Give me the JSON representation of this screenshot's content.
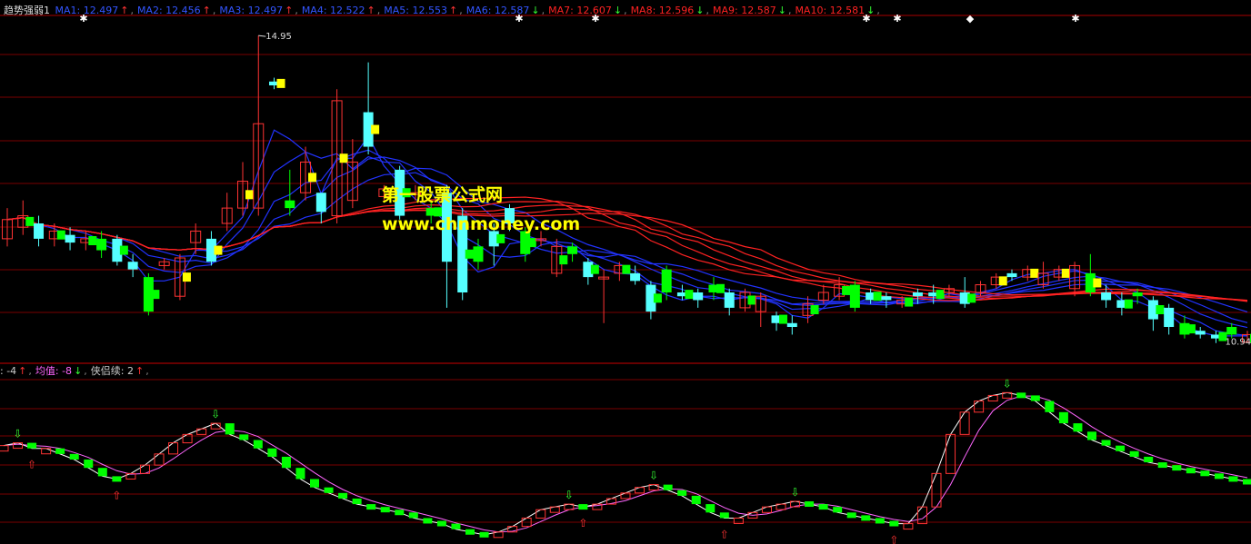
{
  "header": {
    "title": "趋势强弱1",
    "ma_items": [
      {
        "label": "MA1: 12.497",
        "arrow": "↑",
        "color": "#3355ff",
        "arrow_color": "#ff3333"
      },
      {
        "label": "MA2: 12.456",
        "arrow": "↑",
        "color": "#3355ff",
        "arrow_color": "#ff3333"
      },
      {
        "label": "MA3: 12.497",
        "arrow": "↑",
        "color": "#3355ff",
        "arrow_color": "#ff3333"
      },
      {
        "label": "MA4: 12.522",
        "arrow": "↑",
        "color": "#3355ff",
        "arrow_color": "#ff3333"
      },
      {
        "label": "MA5: 12.553",
        "arrow": "↑",
        "color": "#3355ff",
        "arrow_color": "#ff3333"
      },
      {
        "label": "MA6: 12.587",
        "arrow": "↓",
        "color": "#3355ff",
        "arrow_color": "#33ff33"
      },
      {
        "label": "MA7: 12.607",
        "arrow": "↓",
        "color": "#ff2222",
        "arrow_color": "#33ff33"
      },
      {
        "label": "MA8: 12.596",
        "arrow": "↓",
        "color": "#ff2222",
        "arrow_color": "#33ff33"
      },
      {
        "label": "MA9: 12.587",
        "arrow": "↓",
        "color": "#ff2222",
        "arrow_color": "#33ff33"
      },
      {
        "label": "MA10: 12.581",
        "arrow": "↓",
        "color": "#ff2222",
        "arrow_color": "#33ff33"
      }
    ]
  },
  "subheader": {
    "items": [
      {
        "label": ": -4",
        "arrow": "↑",
        "color": "#cccccc",
        "arrow_color": "#ff3333"
      },
      {
        "label": "均值: -8",
        "arrow": "↓",
        "color": "#ff66ff",
        "arrow_color": "#33ff33"
      },
      {
        "label": "侠侣续: 2",
        "arrow": "↑",
        "color": "#cccccc",
        "arrow_color": "#ff3333"
      }
    ]
  },
  "watermark": {
    "line1": "第一股票公式网",
    "line2": "www.chnmoney.com"
  },
  "annotations": {
    "high": "14.95",
    "low": "10.94"
  },
  "colors": {
    "up_hollow": "#ff3333",
    "down_cyan": "#55ffff",
    "down_green": "#00ff00",
    "yellow": "#ffff00",
    "ma_blue": "#2233ff",
    "ma_red": "#ff2222",
    "avg_line": "#ff66ff",
    "grid": "#7a0000"
  },
  "chart_data": [
    {
      "type": "candlestick",
      "title": "趋势强弱1",
      "n": 80,
      "ohlc": [
        [
          12.3,
          12.55,
          12.7,
          12.2
        ],
        [
          12.45,
          12.6,
          12.8,
          12.35
        ],
        [
          12.5,
          12.3,
          12.6,
          12.2
        ],
        [
          12.3,
          12.4,
          12.5,
          12.2
        ],
        [
          12.35,
          12.25,
          12.45,
          12.15
        ],
        [
          12.25,
          12.3,
          12.4,
          12.15
        ],
        [
          12.3,
          12.15,
          12.4,
          12.05
        ],
        [
          12.3,
          12.0,
          12.35,
          11.95
        ],
        [
          12.0,
          11.9,
          12.1,
          11.8
        ],
        [
          11.8,
          11.35,
          11.85,
          11.3
        ],
        [
          11.95,
          12.0,
          12.05,
          11.9
        ],
        [
          11.55,
          12.05,
          12.1,
          11.5
        ],
        [
          12.25,
          12.4,
          12.5,
          12.1
        ],
        [
          12.3,
          12.0,
          12.4,
          11.95
        ],
        [
          12.5,
          12.7,
          12.9,
          12.4
        ],
        [
          12.7,
          13.05,
          13.3,
          12.6
        ],
        [
          12.7,
          13.8,
          14.95,
          12.6
        ],
        [
          14.35,
          14.3,
          14.4,
          14.25
        ],
        [
          12.8,
          12.7,
          13.2,
          12.6
        ],
        [
          12.9,
          13.3,
          13.5,
          12.8
        ],
        [
          12.9,
          12.65,
          12.7,
          12.5
        ],
        [
          12.6,
          14.1,
          14.25,
          12.5
        ],
        [
          12.8,
          13.3,
          13.6,
          12.7
        ],
        [
          13.95,
          13.5,
          14.6,
          13.4
        ],
        [
          12.85,
          12.95,
          13.0,
          12.8
        ],
        [
          13.2,
          12.6,
          13.25,
          12.55
        ],
        [
          12.9,
          12.9,
          13.0,
          12.8
        ],
        [
          12.7,
          12.6,
          12.8,
          12.5
        ],
        [
          12.9,
          12.0,
          13.0,
          11.4
        ],
        [
          12.6,
          11.6,
          12.7,
          11.5
        ],
        [
          12.2,
          12.0,
          12.3,
          11.9
        ],
        [
          12.4,
          12.2,
          12.5,
          11.95
        ],
        [
          12.7,
          12.5,
          12.75,
          12.4
        ],
        [
          12.4,
          12.1,
          12.45,
          12.0
        ],
        [
          12.3,
          12.3,
          12.4,
          12.2
        ],
        [
          11.85,
          12.2,
          12.3,
          11.8
        ],
        [
          12.2,
          12.1,
          12.25,
          12.0
        ],
        [
          12.0,
          11.8,
          12.05,
          11.7
        ],
        [
          11.8,
          11.8,
          11.9,
          11.2
        ],
        [
          11.85,
          11.95,
          12.0,
          11.75
        ],
        [
          11.85,
          11.75,
          11.95,
          11.7
        ],
        [
          11.7,
          11.35,
          11.75,
          11.25
        ],
        [
          11.9,
          11.6,
          11.95,
          11.5
        ],
        [
          11.6,
          11.55,
          11.7,
          11.5
        ],
        [
          11.6,
          11.5,
          11.65,
          11.4
        ],
        [
          11.7,
          11.6,
          11.8,
          11.5
        ],
        [
          11.6,
          11.4,
          11.65,
          11.3
        ],
        [
          11.4,
          11.6,
          11.65,
          11.35
        ],
        [
          11.35,
          11.55,
          11.6,
          11.15
        ],
        [
          11.3,
          11.2,
          11.35,
          11.1
        ],
        [
          11.2,
          11.15,
          11.3,
          11.05
        ],
        [
          11.3,
          11.45,
          11.55,
          11.2
        ],
        [
          11.5,
          11.6,
          11.7,
          11.45
        ],
        [
          11.55,
          11.7,
          11.8,
          11.5
        ],
        [
          11.7,
          11.4,
          11.75,
          11.35
        ],
        [
          11.6,
          11.5,
          11.65,
          11.45
        ],
        [
          11.55,
          11.5,
          11.6,
          11.4
        ],
        [
          11.45,
          11.5,
          11.55,
          11.4
        ],
        [
          11.6,
          11.55,
          11.65,
          11.45
        ],
        [
          11.6,
          11.55,
          11.7,
          11.45
        ],
        [
          11.6,
          11.65,
          11.7,
          11.55
        ],
        [
          11.6,
          11.45,
          11.8,
          11.4
        ],
        [
          11.6,
          11.7,
          11.75,
          11.55
        ],
        [
          11.7,
          11.8,
          11.85,
          11.65
        ],
        [
          11.85,
          11.8,
          11.9,
          11.75
        ],
        [
          11.8,
          11.9,
          11.95,
          11.75
        ],
        [
          11.7,
          11.85,
          12.0,
          11.65
        ],
        [
          11.8,
          11.9,
          11.95,
          11.75
        ],
        [
          11.65,
          11.95,
          12.0,
          11.55
        ],
        [
          11.85,
          11.6,
          12.1,
          11.55
        ],
        [
          11.6,
          11.5,
          11.7,
          11.4
        ],
        [
          11.5,
          11.4,
          11.6,
          11.3
        ],
        [
          11.6,
          11.55,
          11.65,
          11.45
        ],
        [
          11.5,
          11.25,
          11.55,
          11.1
        ],
        [
          11.4,
          11.15,
          11.45,
          11.05
        ],
        [
          11.2,
          11.05,
          11.3,
          11.0
        ],
        [
          11.1,
          11.05,
          11.15,
          11.0
        ],
        [
          11.05,
          11.0,
          11.1,
          10.94
        ],
        [
          11.15,
          11.05,
          11.2,
          11.0
        ],
        [
          10.95,
          11.05,
          11.1,
          10.94
        ]
      ],
      "ylim": [
        10.7,
        15.2
      ]
    },
    {
      "type": "line",
      "series": [
        {
          "values": [
            2,
            3,
            1,
            1,
            -1,
            -3,
            -6,
            -9,
            -10,
            -8,
            -5,
            -1,
            3,
            6,
            8,
            10,
            6,
            4,
            1,
            -2,
            -6,
            -10,
            -13,
            -15,
            -17,
            -19,
            -20,
            -21,
            -22,
            -24,
            -25,
            -26,
            -28,
            -29,
            -30,
            -29,
            -27,
            -24,
            -21,
            -20,
            -19,
            -20,
            -19,
            -17,
            -15,
            -13,
            -12,
            -14,
            -16,
            -19,
            -22,
            -24,
            -24,
            -22,
            -20,
            -19,
            -18,
            -19,
            -20,
            -22,
            -23,
            -24,
            -25,
            -26,
            -26,
            -20,
            -8,
            6,
            14,
            18,
            20,
            21,
            20,
            18,
            14,
            10,
            7,
            4,
            2,
            0,
            -2,
            -4,
            -5,
            -6,
            -7,
            -8,
            -9,
            -10,
            -11
          ]
        }
      ]
    }
  ]
}
